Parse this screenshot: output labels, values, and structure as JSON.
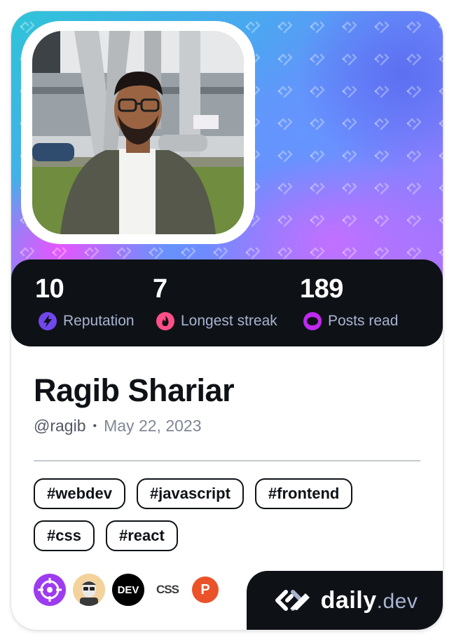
{
  "stats": {
    "reputation": {
      "value": "10",
      "label": "Reputation",
      "icon": "lightning-icon",
      "color": "#7147ed"
    },
    "streak": {
      "value": "7",
      "label": "Longest streak",
      "icon": "flame-icon",
      "color": "#ff4f87"
    },
    "posts": {
      "value": "189",
      "label": "Posts read",
      "icon": "eye-icon",
      "color": "#c029f0"
    }
  },
  "profile": {
    "name": "Ragib Shariar",
    "username": "@ragib",
    "separator": "•",
    "joined": "May 22, 2023"
  },
  "tags": [
    "#webdev",
    "#javascript",
    "#frontend",
    "#css",
    "#react"
  ],
  "sources": [
    {
      "icon": "crosshair-source-icon",
      "color": "#9d3bf0"
    },
    {
      "icon": "avatar-source-icon",
      "color": "#f3d39b"
    },
    {
      "icon": "dev-to-source-icon",
      "text": "DEV",
      "color": "#000000"
    },
    {
      "icon": "css-tricks-source-icon",
      "text": "CSS",
      "color": "#ffffff"
    },
    {
      "icon": "product-hunt-source-icon",
      "text": "P",
      "color": "#ea532a"
    }
  ],
  "brand": {
    "name": "daily",
    "suffix": ".dev",
    "icon": "daily-dev-logo-icon"
  }
}
